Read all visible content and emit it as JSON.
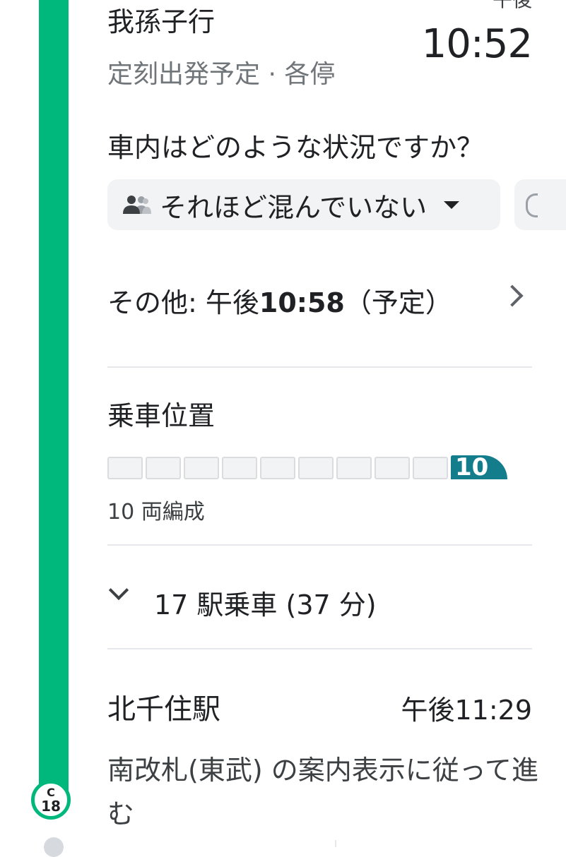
{
  "departure": {
    "destination": "我孫子行",
    "time_label": "午後",
    "time": "10:52",
    "subtitle": "定刻出発予定 · 各停"
  },
  "crowding": {
    "question": "車内はどのような状況ですか？",
    "selected": "それほど混んでいない"
  },
  "other": {
    "prefix": "その他: 午後",
    "time": "10:58",
    "suffix": "（予定）"
  },
  "boarding": {
    "title": "乗車位置",
    "lead_car": "10",
    "formation": "10 両編成"
  },
  "ride": {
    "summary": "17 駅乗車 (37 分)"
  },
  "arrival": {
    "station": "北千住駅",
    "time": "午後11:29",
    "instruction": "南改札(東武) の案内表示に従って進む"
  },
  "station_code": {
    "line": "C",
    "number": "18"
  },
  "colors": {
    "line": "#00b87c",
    "lead_car": "#137d8c"
  }
}
